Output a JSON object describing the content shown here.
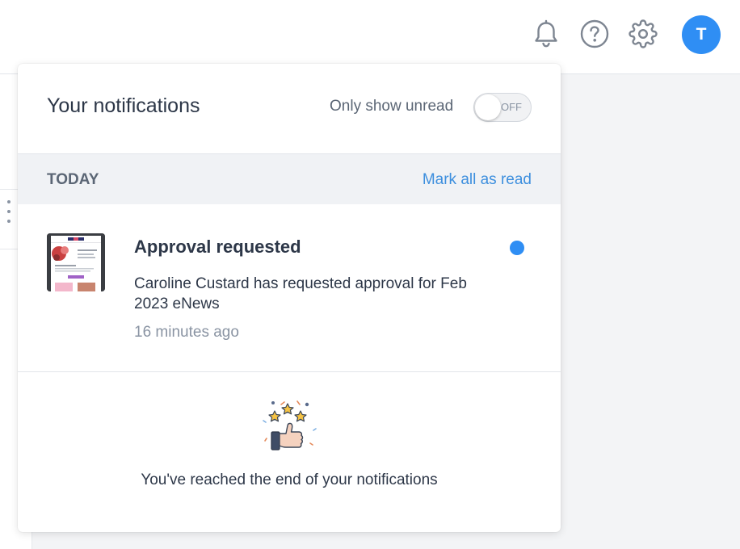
{
  "header": {
    "avatar_initial": "T",
    "icons": [
      "bell-icon",
      "help-icon",
      "gear-icon"
    ]
  },
  "panel": {
    "title": "Your notifications",
    "unread_filter": {
      "label": "Only show unread",
      "state": "OFF"
    },
    "sections": [
      {
        "label": "TODAY",
        "action": "Mark all as read",
        "items": [
          {
            "title": "Approval requested",
            "body": "Caroline Custard has requested approval for Feb 2023 eNews",
            "time": "16 minutes ago",
            "unread": true
          }
        ]
      }
    ],
    "end_message": "You've reached the end of your notifications"
  },
  "colors": {
    "accent": "#2f8ef4",
    "link": "#3d8fde",
    "text": "#2d3748",
    "muted": "#8a94a3",
    "section_bg": "#f0f2f5"
  }
}
